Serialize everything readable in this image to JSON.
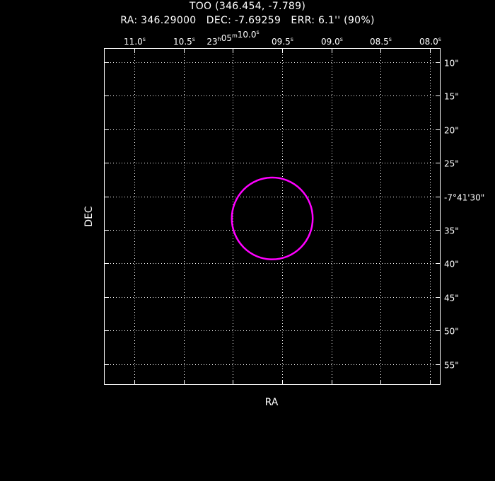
{
  "header": {
    "title": "TOO (346.454, -7.789)",
    "subtitle": "RA: 346.29000   DEC: -7.69259   ERR: 6.1'' (90%)"
  },
  "chart_data": {
    "type": "scatter",
    "xlabel": "RA",
    "ylabel": "DEC",
    "grid": true,
    "x_axis": {
      "position": "top",
      "unit": "seconds of RA (23h05m)",
      "range": [
        11.3,
        7.9
      ],
      "ticks": [
        {
          "value": 11.0,
          "label": "11.0s"
        },
        {
          "value": 10.5,
          "label": "10.5s"
        },
        {
          "value": 10.0,
          "label": "23h05m10.0s"
        },
        {
          "value": 9.5,
          "label": "09.5s"
        },
        {
          "value": 9.0,
          "label": "09.0s"
        },
        {
          "value": 8.5,
          "label": "08.5s"
        },
        {
          "value": 8.0,
          "label": "08.0s"
        }
      ]
    },
    "y_axis": {
      "position": "right",
      "unit": "arcseconds of DEC (-7°41')",
      "range": [
        8,
        58
      ],
      "ticks": [
        {
          "value": 10,
          "label": "10\""
        },
        {
          "value": 15,
          "label": "15\""
        },
        {
          "value": 20,
          "label": "20\""
        },
        {
          "value": 25,
          "label": "25\""
        },
        {
          "value": 30,
          "label": "-7°41'30\""
        },
        {
          "value": 35,
          "label": "35\""
        },
        {
          "value": 40,
          "label": "40\""
        },
        {
          "value": 45,
          "label": "45\""
        },
        {
          "value": 50,
          "label": "50\""
        },
        {
          "value": 55,
          "label": "55\""
        }
      ]
    },
    "error_circle": {
      "center_ra_s": 9.6,
      "center_dec_s": 33.3,
      "radius_arcsec": 6.1,
      "color": "#ff00ff"
    },
    "colors": {
      "background": "#000000",
      "axes": "#ffffff",
      "grid": "#ffffff"
    }
  }
}
